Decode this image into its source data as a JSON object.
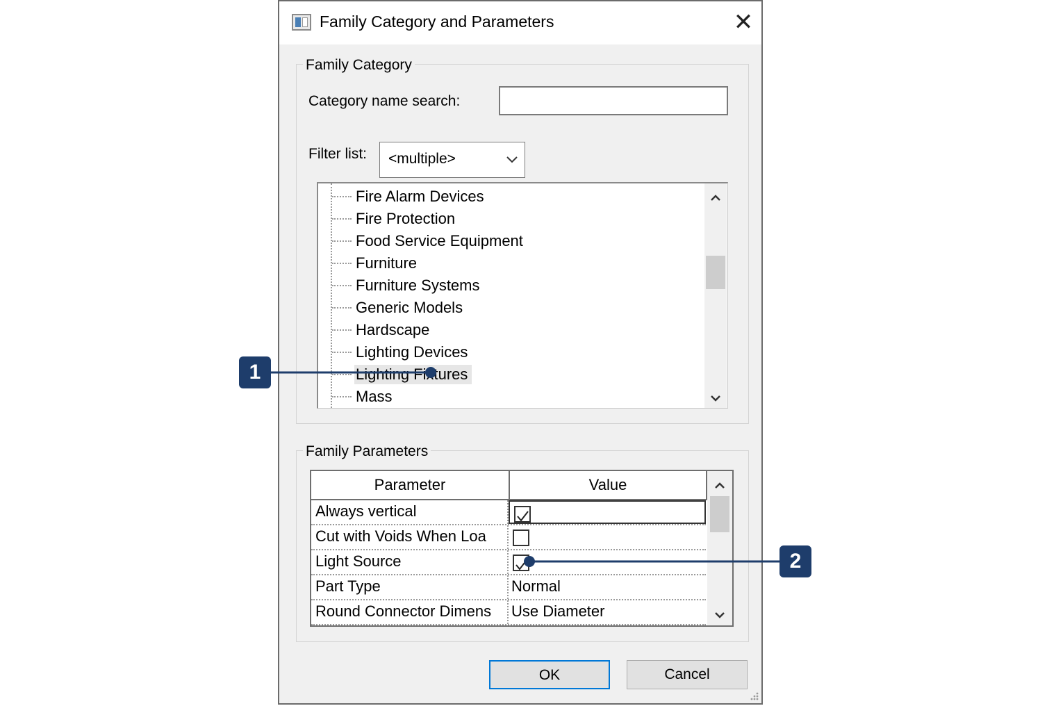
{
  "dialog": {
    "title": "Family Category and Parameters",
    "close_icon": "close-icon"
  },
  "family_category": {
    "legend": "Family Category",
    "search_label": "Category name search:",
    "search_value": "",
    "filter_label": "Filter list:",
    "filter_value": "<multiple>",
    "items": [
      "Fire Alarm Devices",
      "Fire Protection",
      "Food Service Equipment",
      "Furniture",
      "Furniture Systems",
      "Generic Models",
      "Hardscape",
      "Lighting Devices",
      "Lighting Fixtures",
      "Mass"
    ],
    "selected_item": "Lighting Fixtures"
  },
  "family_parameters": {
    "legend": "Family Parameters",
    "columns": [
      "Parameter",
      "Value"
    ],
    "rows": [
      {
        "parameter": "Always vertical",
        "type": "checkbox",
        "checked": true
      },
      {
        "parameter": "Cut with Voids When Loa",
        "type": "checkbox",
        "checked": false
      },
      {
        "parameter": "Light Source",
        "type": "checkbox",
        "checked": true
      },
      {
        "parameter": "Part Type",
        "type": "text",
        "value": "Normal"
      },
      {
        "parameter": "Round Connector Dimens",
        "type": "text",
        "value": "Use Diameter"
      }
    ]
  },
  "buttons": {
    "ok": "OK",
    "cancel": "Cancel"
  },
  "callouts": [
    "1",
    "2"
  ],
  "colors": {
    "callout": "#1e3d6b",
    "default_button_border": "#0078d7",
    "dialog_bg": "#f0f0f0"
  }
}
